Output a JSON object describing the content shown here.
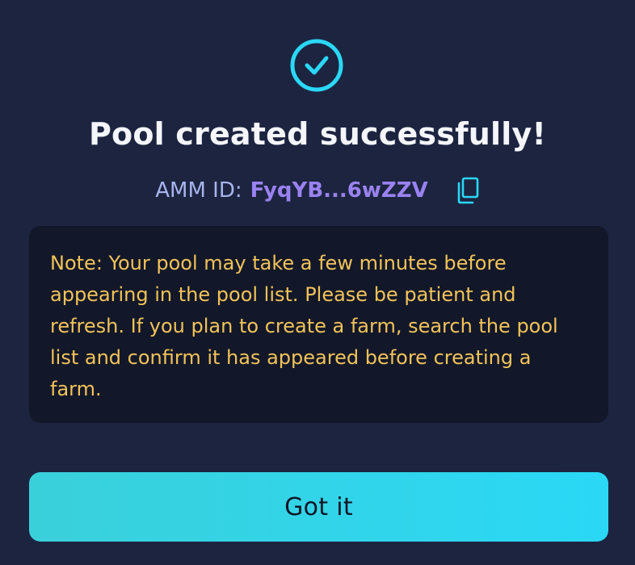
{
  "dialog": {
    "title": "Pool created successfully!",
    "amm_label": "AMM ID:",
    "amm_id": "FyqYB...6wZZV",
    "note": "Note: Your pool may take a few minutes before appearing in the pool list. Please be patient and refresh. If you plan to create a farm, search the pool list and confirm it has appeared before creating a farm.",
    "button_label": "Got it"
  },
  "icons": {
    "success": "check-circle-icon",
    "copy": "copy-icon"
  },
  "colors": {
    "background": "#1c2440",
    "accent": "#2ad8f6",
    "note_text": "#f2c35a",
    "amm_value": "#9a82f0"
  }
}
